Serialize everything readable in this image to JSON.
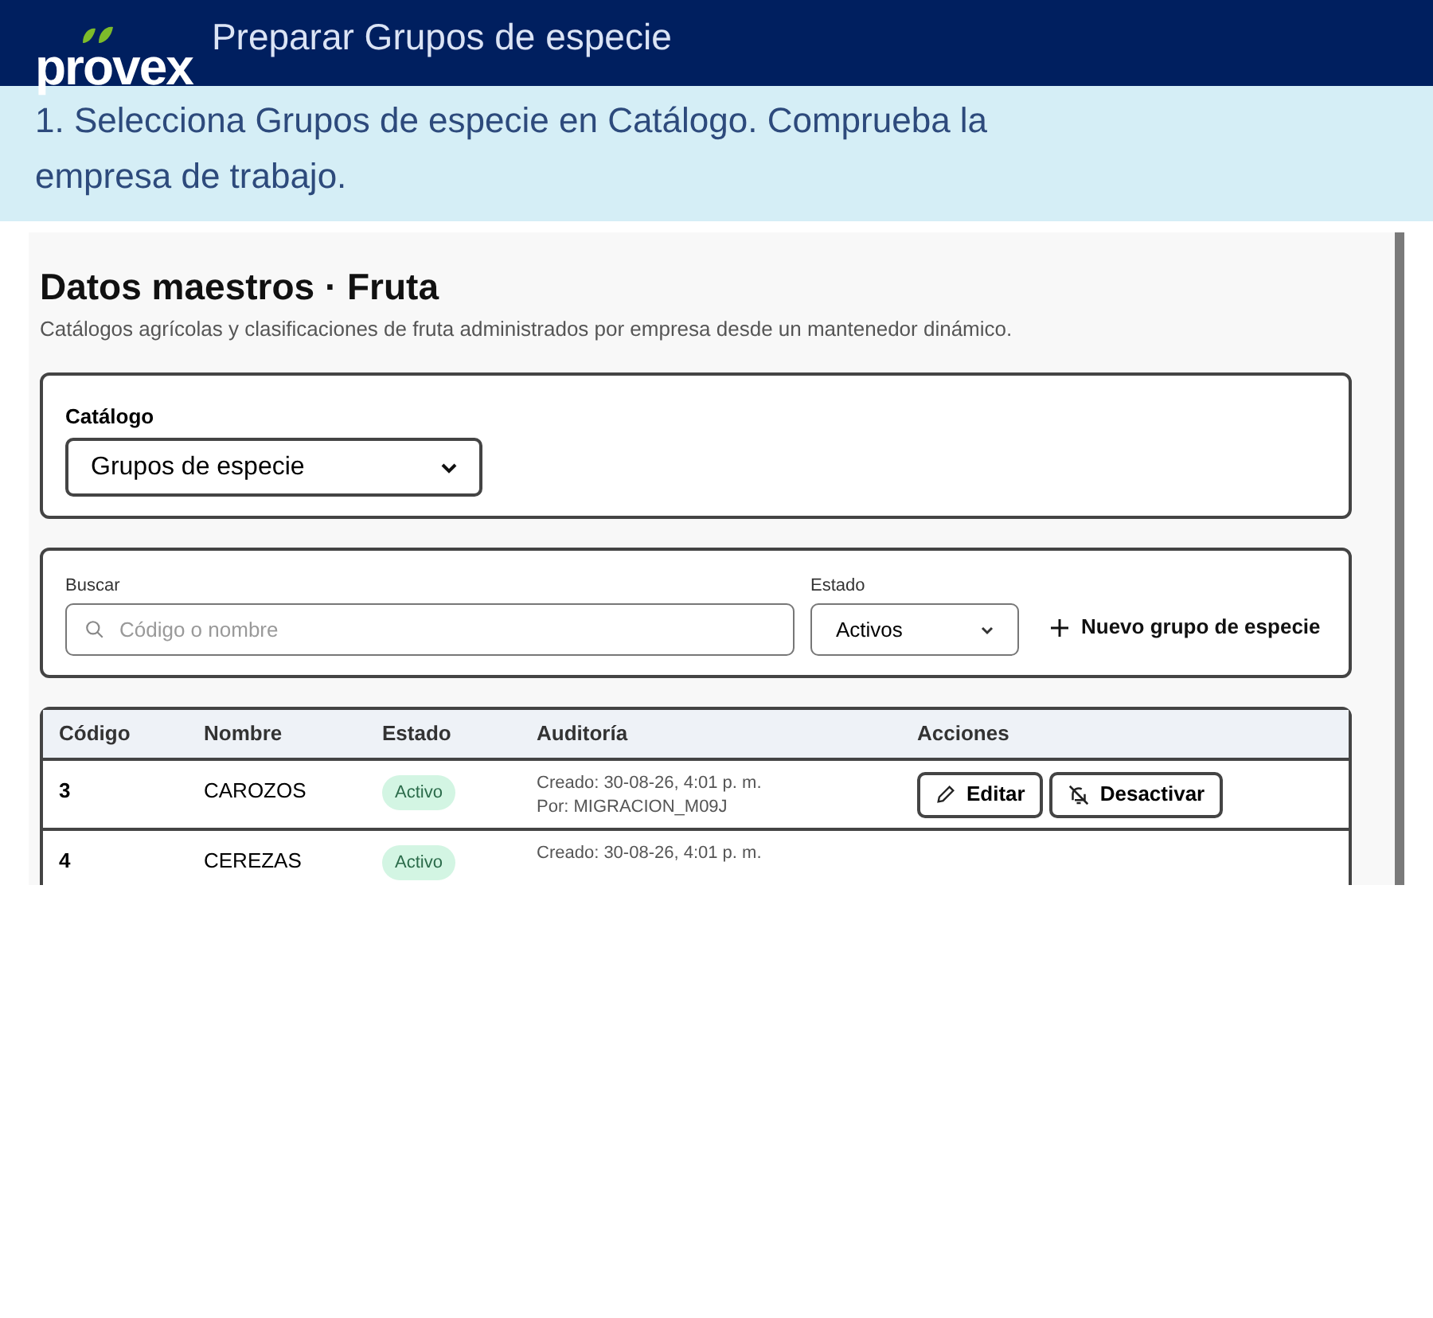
{
  "header": {
    "logo": "provex",
    "title": "Preparar Grupos de especie"
  },
  "instruction": "1. Selecciona Grupos de especie en Catálogo. Comprueba la empresa de trabajo.",
  "screenshot": {
    "title": "Datos maestros · Fruta",
    "subtitle": "Catálogos agrícolas y clasificaciones de fruta administrados por empresa desde un mantenedor dinámico.",
    "catalog": {
      "label": "Catálogo",
      "value": "Grupos de especie"
    },
    "search": {
      "label": "Buscar",
      "placeholder": "Código o nombre"
    },
    "status_filter": {
      "label": "Estado",
      "value": "Activos"
    },
    "new_button": "Nuevo grupo de especie",
    "table": {
      "columns": [
        "Código",
        "Nombre",
        "Estado",
        "Auditoría",
        "Acciones"
      ],
      "rows": [
        {
          "code": "3",
          "name": "CAROZOS",
          "status": "Activo",
          "created": "Creado: 30-08-26, 4:01 p. m.",
          "by": "Por: MIGRACION_M09J",
          "actions": [
            "Editar",
            "Desactivar"
          ]
        },
        {
          "code": "4",
          "name": "CEREZAS",
          "status": "Activo",
          "created": "Creado: 30-08-26, 4:01 p. m.",
          "actions": []
        }
      ]
    }
  }
}
